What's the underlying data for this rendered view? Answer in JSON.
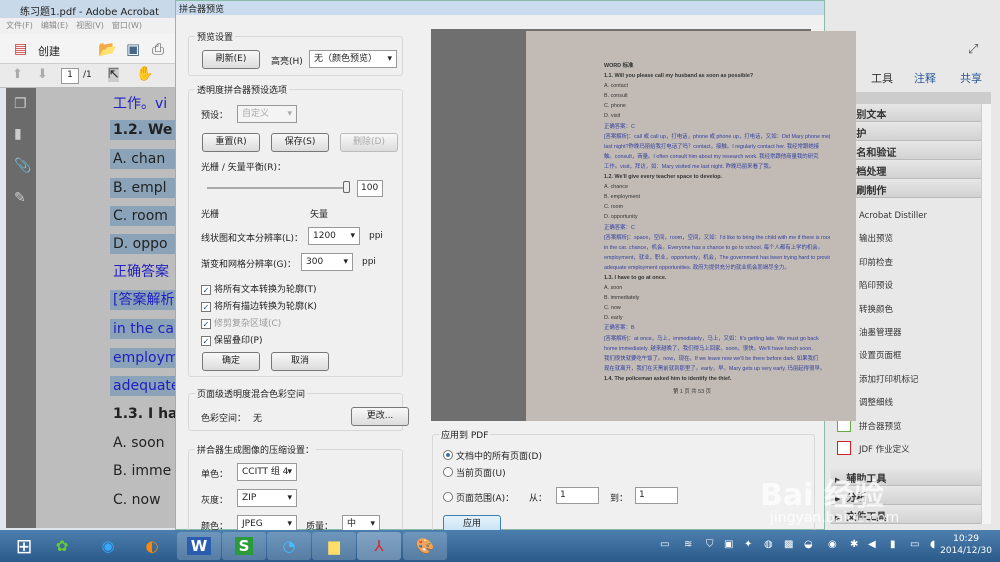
{
  "app": {
    "title": "练习题1.pdf - Adobe Acrobat Pro",
    "menu": [
      "文件(F)",
      "编辑(E)",
      "视图(V)",
      "窗口(W)"
    ],
    "create_label": "创建",
    "page_current": "1",
    "page_total": "/1"
  },
  "doc_lines": [
    {
      "text": "工作。vi",
      "style": "blue"
    },
    {
      "text": "1.2.  We",
      "style": "hlb"
    },
    {
      "text": "A.  chan",
      "style": "hl"
    },
    {
      "text": "B.  empl",
      "style": "hl"
    },
    {
      "text": "C.  room",
      "style": "hl"
    },
    {
      "text": "D.  oppo",
      "style": "hl"
    },
    {
      "text": "正确答案",
      "style": "blue"
    },
    {
      "text": "[答案解析",
      "style": "hlblue"
    },
    {
      "text": "in the ca",
      "style": "hlblue"
    },
    {
      "text": "employm",
      "style": "hlblue"
    },
    {
      "text": "adequate",
      "style": "hlblue"
    },
    {
      "text": "1.3.  I ha",
      "style": "b"
    },
    {
      "text": "A.  soon",
      "style": ""
    },
    {
      "text": "B.  imme",
      "style": ""
    },
    {
      "text": "C.  now",
      "style": ""
    }
  ],
  "dialog": {
    "title": "拼合器预览",
    "preview_settings": {
      "label": "预览设置",
      "refresh": "刷新(E)",
      "highlight_label": "高亮(H)",
      "highlight_value": "无（颜色预览）"
    },
    "presets": {
      "label": "透明度拼合器预设选项",
      "preset_label": "预设：",
      "preset_value": "自定义",
      "reset": "重置(R)",
      "save": "保存(S)",
      "delete": "删除(D)",
      "balance_label": "光栅 / 矢量平衡(R)：",
      "balance_value": "100",
      "balance_fraction": 1.0,
      "raster": "光栅",
      "vector": "矢量",
      "line_res_label": "线状图和文本分辨率(L)：",
      "line_res_value": "1200",
      "grad_res_label": "渐变和网格分辨率(G)：",
      "grad_res_value": "300",
      "ppi": "ppi",
      "checkboxes": [
        {
          "label": "将所有文本转换为轮廓(T)",
          "checked": true,
          "disabled": false
        },
        {
          "label": "将所有描边转换为轮廓(K)",
          "checked": true,
          "disabled": false
        },
        {
          "label": "修剪复杂区域(C)",
          "checked": true,
          "disabled": true
        },
        {
          "label": "保留叠印(P)",
          "checked": true,
          "disabled": false
        }
      ],
      "ok": "确定",
      "cancel": "取消"
    },
    "colorspace": {
      "label": "页面级透明度混合色彩空间",
      "space_label": "色彩空间：",
      "space_value": "无",
      "change": "更改..."
    },
    "compression": {
      "label": "拼合器生成图像的压缩设置：",
      "mono_label": "单色：",
      "mono_value": "CCITT 组 4",
      "gray_label": "灰度：",
      "gray_value": "ZIP",
      "color_label": "颜色：",
      "color_value": "JPEG",
      "quality_label": "质量：",
      "quality_value": "中"
    },
    "apply": {
      "label": "应用到 PDF",
      "all_pages": "文档中的所有页面(D)",
      "current_page": "当前页面(U)",
      "page_range": "页面范围(A)：",
      "from_label": "从：",
      "from_value": "1",
      "to_label": "到：",
      "to_value": "1",
      "apply": "应用",
      "selected": "all_pages"
    }
  },
  "preview_page": [
    {
      "t": "WORD 标准",
      "c": "b"
    },
    {
      "t": "1.1.  Will you please call my husband as soon as possible?",
      "c": "b"
    },
    {
      "t": "A.  contact",
      "c": ""
    },
    {
      "t": "B.  consult",
      "c": ""
    },
    {
      "t": "C.  phone",
      "c": ""
    },
    {
      "t": "D.  visit",
      "c": ""
    },
    {
      "t": "正确答案：C",
      "c": "a"
    },
    {
      "t": "[答案解析]：call 或 call up，打电话，phone 或 phone up，打电话，又如：Did Mary phone me|up",
      "c": "a"
    },
    {
      "t": "last night?昨晚玛丽给我打电话了吗？contact，接触。I regularly contact her. 我经常跟她接",
      "c": "a"
    },
    {
      "t": "触。consult，商量。I often consult him about my research work. 我经常跟他商量我的研究",
      "c": "a"
    },
    {
      "t": "工作。visit，拜访，如：Mary visited me last night. 昨晚玛丽来看了我。",
      "c": "a"
    },
    {
      "t": "1.2.  We'll give every teacher space to develop.",
      "c": "b"
    },
    {
      "t": "A.  chance",
      "c": ""
    },
    {
      "t": "B.  employment",
      "c": ""
    },
    {
      "t": "C.  room",
      "c": ""
    },
    {
      "t": "D.  opportunity",
      "c": ""
    },
    {
      "t": "正确答案：C",
      "c": "a"
    },
    {
      "t": "[答案解析]：space，空间，room，空间，又如：I'd like to bring the child with me if there is room",
      "c": "a"
    },
    {
      "t": "in the car. chance，机会。Everyone has a chance to go to school. 每个人都有上学的机会。",
      "c": "a"
    },
    {
      "t": "employment，就业，职业，opportunity，机会，The government has been trying hard to provide",
      "c": "a"
    },
    {
      "t": "adequate employment opportunities. 政府为提供充分的就业机会而竭尽全力。",
      "c": "a"
    },
    {
      "t": "1.3.  I have to go at once.",
      "c": "b"
    },
    {
      "t": "A.  soon",
      "c": ""
    },
    {
      "t": "B.  immediately",
      "c": ""
    },
    {
      "t": "C.  now",
      "c": ""
    },
    {
      "t": "D.  early",
      "c": ""
    },
    {
      "t": "正确答案：B",
      "c": "a"
    },
    {
      "t": "[答案解析]：at once，马上，immediately，马上，又如：It's getting late. We must go back",
      "c": "a"
    },
    {
      "t": "home immediately. 越来越晚了，我们得马上回家。soon，很快。We'll have lunch soon.",
      "c": "a"
    },
    {
      "t": "我们很快就要吃午饭了。now，现在。If we leave now we'll be there before dark. 如果我们",
      "c": "a"
    },
    {
      "t": "现在就离开，我们在天黑前就到那里了。early，早。Mary gets up very early. 玛丽起得很早。",
      "c": "a"
    },
    {
      "t": "1.4.  The policeman asked him to identify the thief.",
      "c": "b"
    }
  ],
  "preview_footer": "第 1 页 共 53 页",
  "right_panel": {
    "tabs": [
      "工具",
      "注释",
      "共享"
    ],
    "sections_top": [
      "识别文本",
      "保护",
      "签名和验证",
      "文档处理"
    ],
    "open_section": "印刷制作",
    "tools": [
      "Acrobat Distiller",
      "输出预览",
      "印前检查",
      "陷印预设",
      "转换颜色",
      "油墨管理器",
      "设置页面框",
      "添加打印机标记",
      "调整细线",
      "拼合器预览",
      "JDF 作业定义"
    ],
    "sections_bottom": [
      "辅助工具",
      "分析",
      "文件工具"
    ]
  },
  "taskbar": {
    "apps": [
      "windows-start",
      "360-browser",
      "chat",
      "media",
      "wps-writer",
      "wps-sheet",
      "qq-browser",
      "folder",
      "acrobat",
      "paint"
    ],
    "time": "10:29",
    "date": "2014/12/30"
  },
  "watermark": {
    "text": "Bai 经验",
    "url": "jingyan.baidu.com"
  }
}
